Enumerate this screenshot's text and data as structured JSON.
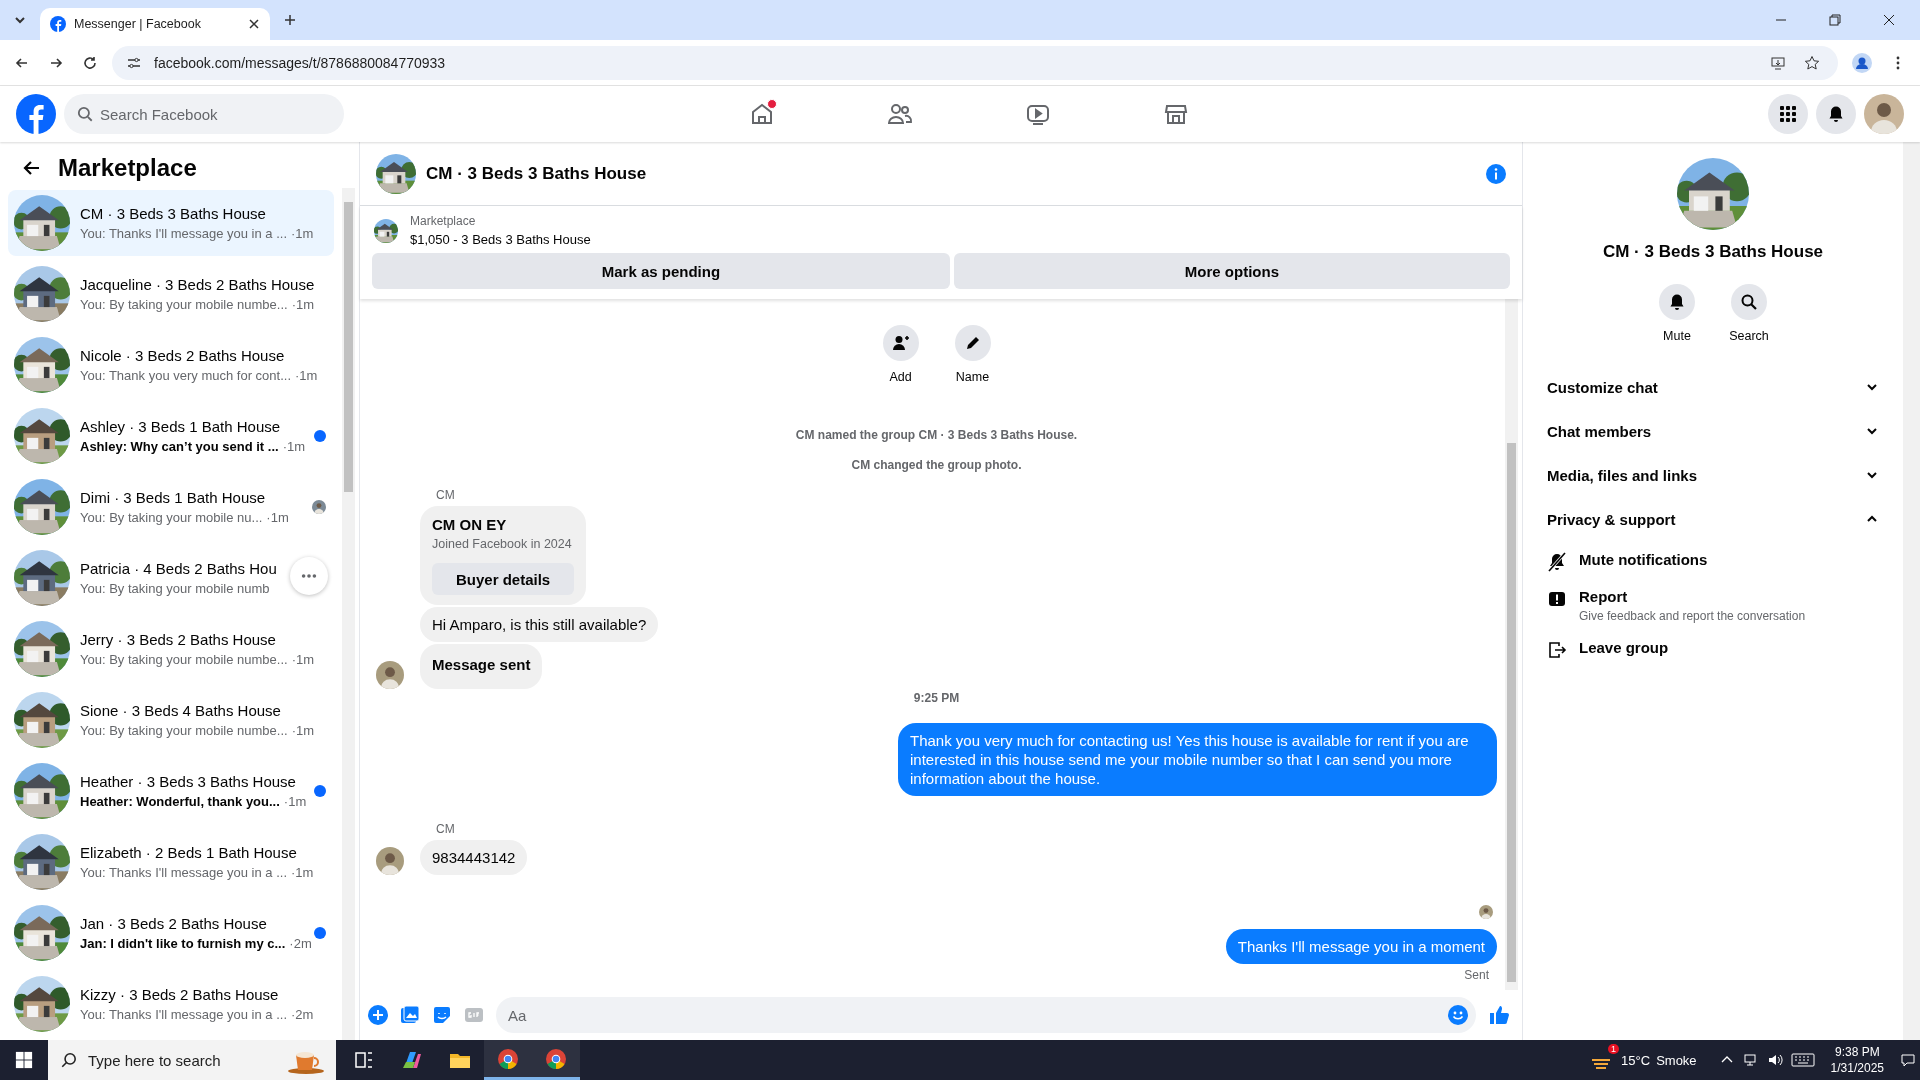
{
  "browser": {
    "tab_title": "Messenger | Facebook",
    "url": "facebook.com/messages/t/8786880084770933"
  },
  "header": {
    "search": {
      "placeholder": "Search Facebook"
    },
    "nav": [
      {
        "kind": "home",
        "badge": true
      },
      {
        "kind": "friends",
        "badge": false
      },
      {
        "kind": "video",
        "badge": false
      },
      {
        "kind": "marketplace",
        "badge": false
      }
    ]
  },
  "sidebar": {
    "title": "Marketplace",
    "conversations": [
      {
        "title": "CM · 3 Beds 3 Baths House",
        "preview": "You: Thanks I'll message you in a ...",
        "time": "·1m",
        "selected": true,
        "unread": false,
        "seen": false,
        "hovered": false
      },
      {
        "title": "Jacqueline · 3 Beds 2 Baths House",
        "preview": "You: By taking your mobile numbe...",
        "time": "·1m",
        "selected": false,
        "unread": false,
        "seen": false,
        "hovered": false
      },
      {
        "title": "Nicole · 3 Beds 2 Baths House",
        "preview": "You: Thank you very much for cont...",
        "time": "·1m",
        "selected": false,
        "unread": false,
        "seen": false,
        "hovered": false
      },
      {
        "title": "Ashley · 3 Beds 1 Bath House",
        "preview": "Ashley: Why can’t you send it ...",
        "time": "·1m",
        "selected": false,
        "unread": true,
        "seen": false,
        "hovered": false
      },
      {
        "title": "Dimi · 3 Beds 1 Bath House",
        "preview": "You: By taking your mobile nu...",
        "time": "·1m",
        "selected": false,
        "unread": false,
        "seen": true,
        "hovered": false
      },
      {
        "title": "Patricia · 4 Beds 2 Baths Hou",
        "preview": "You: By taking your mobile numb",
        "selected": false,
        "unread": false,
        "seen": false,
        "hovered": true
      },
      {
        "title": "Jerry · 3 Beds 2 Baths House",
        "preview": "You: By taking your mobile numbe...",
        "time": "·1m",
        "selected": false,
        "unread": false,
        "seen": false,
        "hovered": false
      },
      {
        "title": "Sione · 3 Beds 4 Baths House",
        "preview": "You: By taking your mobile numbe...",
        "time": "·1m",
        "selected": false,
        "unread": false,
        "seen": false,
        "hovered": false
      },
      {
        "title": "Heather · 3 Beds 3 Baths House",
        "preview": "Heather: Wonderful, thank you...",
        "time": "·1m",
        "selected": false,
        "unread": true,
        "seen": false,
        "hovered": false
      },
      {
        "title": "Elizabeth · 2 Beds 1 Bath House",
        "preview": "You: Thanks I'll message you in a ...",
        "time": "·1m",
        "selected": false,
        "unread": false,
        "seen": false,
        "hovered": false
      },
      {
        "title": "Jan · 3 Beds 2 Baths House",
        "preview": "Jan: I didn't like to furnish my c...",
        "time": "·2m",
        "selected": false,
        "unread": true,
        "seen": false,
        "hovered": false
      },
      {
        "title": "Kizzy · 3 Beds 2 Baths House",
        "preview": "You: Thanks I'll message you in a ...",
        "time": "·2m",
        "selected": false,
        "unread": false,
        "seen": false,
        "hovered": false
      }
    ]
  },
  "chat": {
    "title": "CM · 3 Beds 3 Baths House",
    "listing": {
      "label": "Marketplace",
      "price": "$1,050 - 3 Beds 3 Baths House",
      "buttons": [
        "Mark as pending",
        "More options"
      ]
    },
    "actions": [
      {
        "kind": "add",
        "label": "Add"
      },
      {
        "kind": "edit",
        "label": "Name"
      }
    ],
    "events": [
      "CM named the group CM · 3 Beds 3 Baths House.",
      "CM changed the group photo."
    ],
    "messages": [
      {
        "kind": "sender",
        "text": "CM"
      },
      {
        "kind": "card",
        "name": "CM ON EY",
        "subtitle": "Joined Facebook in 2024",
        "button": "Buyer details"
      },
      {
        "kind": "incoming",
        "text": "Hi Amparo, is this still available?",
        "avatar": false,
        "bold": false
      },
      {
        "kind": "incoming",
        "text": "Message sent",
        "avatar": true,
        "bold": true
      },
      {
        "kind": "time",
        "text": "9:25 PM"
      },
      {
        "kind": "outgoing",
        "text": "Thank you very much for contacting us! Yes this house is available for rent if you are interested in this house send me your mobile number so that I can send you more information about the house."
      },
      {
        "kind": "sender",
        "text": "CM"
      },
      {
        "kind": "incoming",
        "text": "9834443142",
        "avatar": true,
        "bold": false
      },
      {
        "kind": "seen"
      },
      {
        "kind": "outgoing",
        "text": "Thanks I'll message you in a moment"
      },
      {
        "kind": "status",
        "text": "Sent"
      }
    ],
    "composer": {
      "placeholder": "Aa"
    }
  },
  "details": {
    "title": "CM · 3 Beds 3 Baths House",
    "actions": [
      {
        "kind": "bell",
        "label": "Mute"
      },
      {
        "kind": "search",
        "label": "Search"
      }
    ],
    "sections": [
      {
        "label": "Customize chat",
        "expanded": false
      },
      {
        "label": "Chat members",
        "expanded": false
      },
      {
        "label": "Media, files and links",
        "expanded": false
      },
      {
        "label": "Privacy & support",
        "expanded": true
      }
    ],
    "items": [
      {
        "kind": "mute",
        "label": "Mute notifications"
      },
      {
        "kind": "report",
        "label": "Report",
        "description": "Give feedback and report the conversation"
      },
      {
        "kind": "leave",
        "label": "Leave group"
      }
    ]
  },
  "taskbar": {
    "search": {
      "placeholder": "Type here to search"
    },
    "apps": [
      {
        "kind": "taskview",
        "running": false
      },
      {
        "kind": "copilot",
        "running": false
      },
      {
        "kind": "folder",
        "running": false
      },
      {
        "kind": "chrome",
        "running": true
      },
      {
        "kind": "chrome",
        "running": true
      }
    ],
    "weather": {
      "alert": "1",
      "temperature": "15°C",
      "condition": "Smoke"
    },
    "clock": {
      "time": "9:38 PM",
      "date": "1/31/2025"
    }
  }
}
